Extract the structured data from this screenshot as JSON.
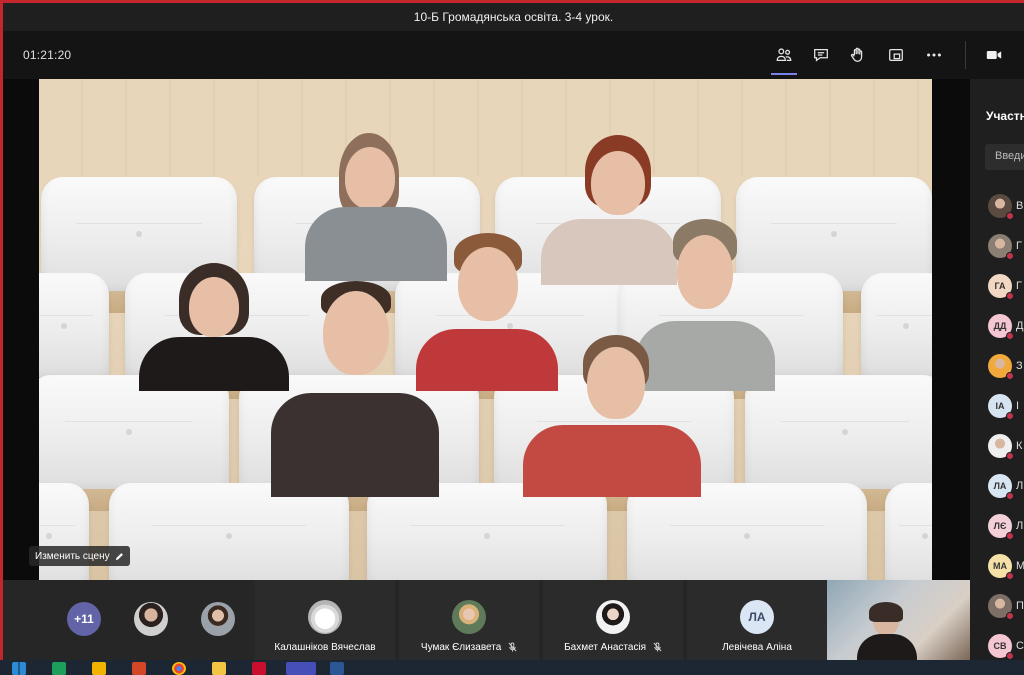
{
  "window": {
    "title": "10-Б Громадянська освіта. 3-4 урок."
  },
  "controls": {
    "timer": "01:21:20",
    "buttons": [
      {
        "icon": "participants-icon",
        "active": true
      },
      {
        "icon": "chat-icon"
      },
      {
        "icon": "raise-hand-icon"
      },
      {
        "icon": "share-tray-icon"
      },
      {
        "icon": "more-options-icon"
      },
      {
        "icon": "camera-icon"
      }
    ]
  },
  "stage": {
    "change_scene_label": "Изменить сцену"
  },
  "panel": {
    "title": "Участни",
    "search_placeholder": "Введи",
    "participants": [
      {
        "initials": "",
        "name": "В",
        "color": "#5a4a3f",
        "photo": true
      },
      {
        "initials": "",
        "name": "Г",
        "color": "#8a7f72",
        "photo": true
      },
      {
        "initials": "ГА",
        "name": "Г",
        "color": "#f2d8c2"
      },
      {
        "initials": "ДД",
        "name": "Д",
        "color": "#f3c6d2"
      },
      {
        "initials": "",
        "name": "З",
        "color": "#f0a93a",
        "photo": true
      },
      {
        "initials": "ІА",
        "name": "І",
        "color": "#d6e4f2"
      },
      {
        "initials": "",
        "name": "К",
        "color": "#efefef",
        "photo": true
      },
      {
        "initials": "ЛА",
        "name": "Л",
        "color": "#d8e6f4"
      },
      {
        "initials": "ЛЄ",
        "name": "Л",
        "color": "#f3cfd8"
      },
      {
        "initials": "МА",
        "name": "М",
        "color": "#f5e1a8"
      },
      {
        "initials": "",
        "name": "П",
        "color": "#7d6f66",
        "photo": true
      },
      {
        "initials": "СВ",
        "name": "С",
        "color": "#f3c6d2"
      }
    ]
  },
  "strip": {
    "more_count": "+11",
    "tiles": [
      {
        "name": "Калашніков Вячеслав",
        "muted": false
      },
      {
        "name": "Чумак Єлизавета",
        "muted": true
      },
      {
        "name": "Бахмет Анастасія",
        "muted": true
      },
      {
        "name": "Левічева Аліна",
        "initials": "ЛА",
        "muted": false
      }
    ]
  }
}
